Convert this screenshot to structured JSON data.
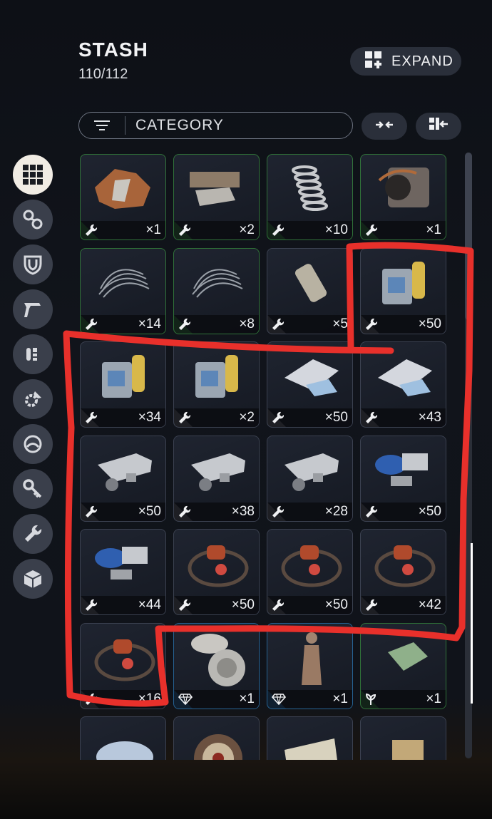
{
  "header": {
    "title": "STASH",
    "count": "110/112",
    "expand_label": "EXPAND"
  },
  "filter": {
    "category_label": "CATEGORY"
  },
  "colors": {
    "green": "#3fa845",
    "blue": "#2e8fd9",
    "gray": "#8b8f96",
    "annotation": "#e8302b"
  },
  "sidebar": {
    "items": [
      {
        "icon": "grid-icon",
        "active": true
      },
      {
        "icon": "attachments-icon",
        "active": false
      },
      {
        "icon": "shield-icon",
        "active": false
      },
      {
        "icon": "weapon-icon",
        "active": false
      },
      {
        "icon": "ammo-icon",
        "active": false
      },
      {
        "icon": "gear-crafting-icon",
        "active": false
      },
      {
        "icon": "ring-icon",
        "active": false
      },
      {
        "icon": "key-icon",
        "active": false
      },
      {
        "icon": "wrench-icon",
        "active": false
      },
      {
        "icon": "box-icon",
        "active": false
      }
    ]
  },
  "items": [
    {
      "name": "leather-scraps",
      "qty": "×1",
      "rarity": "green",
      "type": "wrench"
    },
    {
      "name": "metal-parts",
      "qty": "×2",
      "rarity": "green",
      "type": "wrench"
    },
    {
      "name": "spring",
      "qty": "×10",
      "rarity": "green",
      "type": "wrench"
    },
    {
      "name": "motor",
      "qty": "×1",
      "rarity": "green",
      "type": "wrench"
    },
    {
      "name": "wires",
      "qty": "×14",
      "rarity": "green",
      "type": "wrench"
    },
    {
      "name": "wires",
      "qty": "×8",
      "rarity": "green",
      "type": "wrench"
    },
    {
      "name": "canister",
      "qty": "×5",
      "rarity": "gray",
      "type": "wrench"
    },
    {
      "name": "chemicals",
      "qty": "×50",
      "rarity": "gray",
      "type": "wrench"
    },
    {
      "name": "chemicals",
      "qty": "×34",
      "rarity": "gray",
      "type": "wrench"
    },
    {
      "name": "chemicals",
      "qty": "×2",
      "rarity": "gray",
      "type": "wrench"
    },
    {
      "name": "fabric",
      "qty": "×50",
      "rarity": "gray",
      "type": "wrench"
    },
    {
      "name": "fabric",
      "qty": "×43",
      "rarity": "gray",
      "type": "wrench"
    },
    {
      "name": "metal-bracket",
      "qty": "×50",
      "rarity": "gray",
      "type": "wrench"
    },
    {
      "name": "metal-bracket",
      "qty": "×38",
      "rarity": "gray",
      "type": "wrench"
    },
    {
      "name": "metal-bracket",
      "qty": "×28",
      "rarity": "gray",
      "type": "wrench"
    },
    {
      "name": "blue-bracket",
      "qty": "×50",
      "rarity": "gray",
      "type": "wrench"
    },
    {
      "name": "blue-bracket",
      "qty": "×44",
      "rarity": "gray",
      "type": "wrench"
    },
    {
      "name": "rubber-coil",
      "qty": "×50",
      "rarity": "gray",
      "type": "wrench"
    },
    {
      "name": "rubber-coil",
      "qty": "×50",
      "rarity": "gray",
      "type": "wrench"
    },
    {
      "name": "rubber-coil",
      "qty": "×42",
      "rarity": "gray",
      "type": "wrench"
    },
    {
      "name": "rubber-coil",
      "qty": "×16",
      "rarity": "gray",
      "type": "wrench"
    },
    {
      "name": "disc-device",
      "qty": "×1",
      "rarity": "blue",
      "type": "diamond"
    },
    {
      "name": "statue",
      "qty": "×1",
      "rarity": "blue",
      "type": "diamond"
    },
    {
      "name": "green-item",
      "qty": "×1",
      "rarity": "green",
      "type": "leaf"
    },
    {
      "name": "bowl",
      "qty": "",
      "rarity": "gray",
      "type": "none"
    },
    {
      "name": "dartboard",
      "qty": "",
      "rarity": "gray",
      "type": "none"
    },
    {
      "name": "map",
      "qty": "",
      "rarity": "gray",
      "type": "none"
    },
    {
      "name": "package",
      "qty": "",
      "rarity": "gray",
      "type": "none"
    }
  ]
}
